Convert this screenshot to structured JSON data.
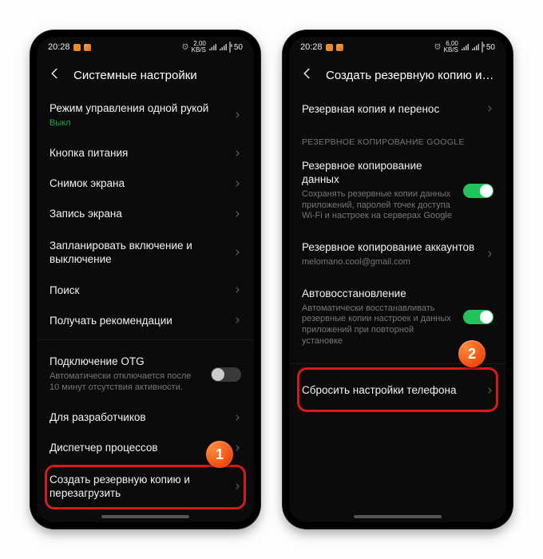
{
  "phone1": {
    "status": {
      "time": "20:28",
      "speed_num": "2,00",
      "speed_unit": "KB/S",
      "battery": "50"
    },
    "title": "Системные настройки",
    "items": {
      "one_hand": {
        "label": "Режим управления одной рукой",
        "sub": "Выкл"
      },
      "power": {
        "label": "Кнопка питания"
      },
      "screenshot": {
        "label": "Снимок экрана"
      },
      "record": {
        "label": "Запись экрана"
      },
      "schedule": {
        "label": "Запланировать включение и выключение"
      },
      "search": {
        "label": "Поиск"
      },
      "recs": {
        "label": "Получать рекомендации"
      },
      "otg": {
        "label": "Подключение OTG",
        "sub": "Автоматически отключается после 10 минут отсутствия активности."
      },
      "dev": {
        "label": "Для разработчиков"
      },
      "procman": {
        "label": "Диспетчер процессов"
      },
      "backup": {
        "label": "Создать резервную копию и перезагрузить"
      }
    },
    "marker": "1"
  },
  "phone2": {
    "status": {
      "time": "20:28",
      "speed_num": "6,00",
      "speed_unit": "KB/S",
      "battery": "50"
    },
    "title": "Создать резервную копию и перезаг...",
    "items": {
      "backup_transfer": {
        "label": "Резервная копия и перенос"
      },
      "section": "РЕЗЕРВНОЕ КОПИРОВАНИЕ GOOGLE",
      "data_backup": {
        "label": "Резервное копирование данных",
        "sub": "Сохранять резервные копии данных приложений, паролей точек доступа Wi-Fi и настроек на серверах Google"
      },
      "account_backup": {
        "label": "Резервное копирование аккаунтов",
        "sub": "melomano.cool@gmail.com"
      },
      "autorestore": {
        "label": "Автовосстановление",
        "sub": "Автоматически восстанавливать резервные копии настроек и данных приложений при повторной установке"
      },
      "reset": {
        "label": "Сбросить настройки телефона"
      }
    },
    "marker": "2"
  }
}
